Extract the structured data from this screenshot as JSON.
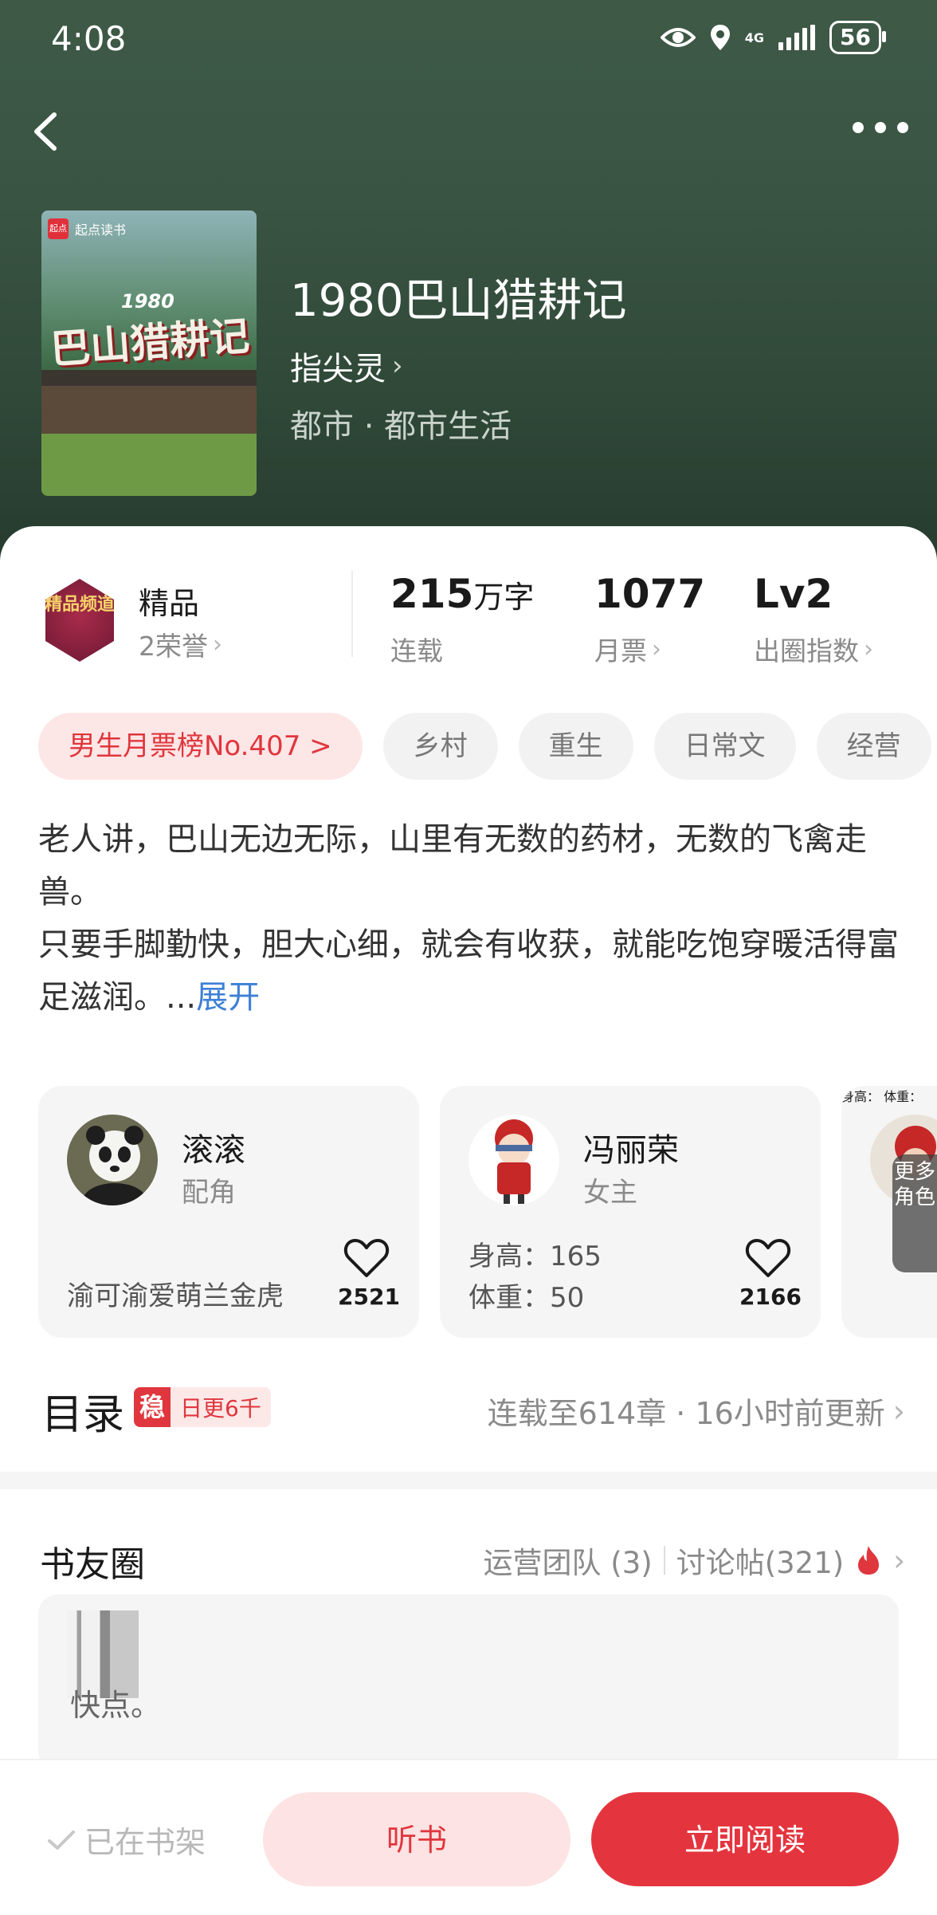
{
  "status_bar": {
    "time": "4:08",
    "network": "4G",
    "battery": "56"
  },
  "book": {
    "cover_brand": "起点读书",
    "cover_brand_logo": "起点",
    "cover_year": "1980",
    "cover_title": "巴山猎耕记",
    "title": "1980巴山猎耕记",
    "author": "指尖灵",
    "genre": "都市 · 都市生活"
  },
  "stats": {
    "quality_badge": "精品频道",
    "quality_label": "精品",
    "honors": "2荣誉",
    "word_count": "215",
    "word_unit": "万字",
    "status": "连载",
    "monthly_tickets": "1077",
    "monthly_tickets_label": "月票",
    "popularity_level": "Lv2",
    "popularity_label": "出圈指数"
  },
  "tags": [
    "男生月票榜No.407 >",
    "乡村",
    "重生",
    "日常文",
    "经营"
  ],
  "description": {
    "line1": "老人讲，巴山无边无际，山里有无数的药材，无数的飞禽走兽。",
    "line2": "只要手脚勤快，胆大心细，就会有收获，就能吃饱穿暖活得富足滋润。...",
    "expand": "展开"
  },
  "roles": [
    {
      "name": "滚滚",
      "role": "配角",
      "detail": "渝可渝爱萌兰金虎",
      "likes": "2521"
    },
    {
      "name": "冯丽荣",
      "role": "女主",
      "height": "身高：165",
      "weight": "体重：50",
      "likes": "2166"
    },
    {
      "partial_line1": "身高：",
      "partial_line2": "体重："
    }
  ],
  "more_roles": "更多角色",
  "toc": {
    "title": "目录",
    "badge_icon": "稳",
    "badge_text": "日更6千",
    "status": "连载至614章 · 16小时前更新"
  },
  "book_circle": {
    "title": "书友圈",
    "ops_team": "运营团队 (3)",
    "posts": "讨论帖(321)",
    "preview": "快点。"
  },
  "bottom": {
    "on_shelf": "已在书架",
    "listen": "听书",
    "read": "立即阅读"
  },
  "colors": {
    "accent": "#e4353f",
    "hero_bg": "#3a5443",
    "link": "#3d7fd6"
  }
}
